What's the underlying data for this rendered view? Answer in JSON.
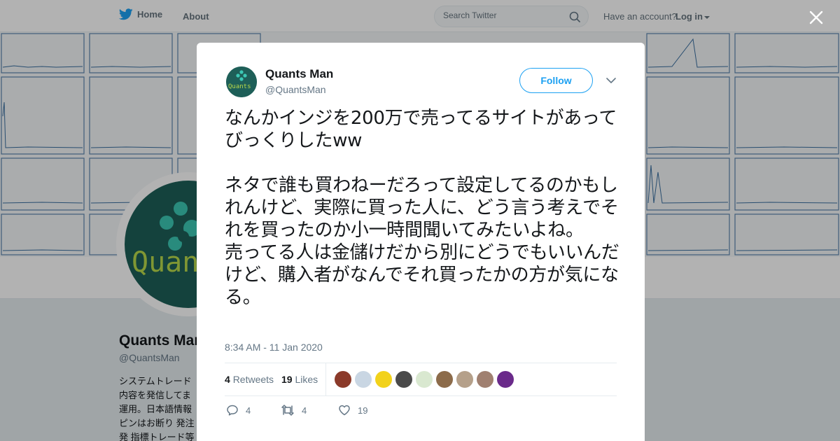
{
  "nav": {
    "home_label": "Home",
    "about_label": "About",
    "search_placeholder": "Search Twitter",
    "have_account": "Have an account?",
    "login_label": "Log in"
  },
  "background_profile": {
    "name": "Quants Man",
    "handle": "@QuantsMan",
    "bio": "システムトレード\n内容を発信してま\n運用。日本語情報\nピンはお断り 発注\n発 指標トレード等"
  },
  "tweet": {
    "author_name": "Quants Man",
    "author_handle": "@QuantsMan",
    "follow_label": "Follow",
    "text": "なんかインジを200万で売ってるサイトがあってびっくりしたww\n\nネタで誰も買わねーだろって設定してるのかもしれんけど、実際に買った人に、どう言う考えでそれを買ったのか小一時間聞いてみたいよね。\n売ってる人は金儲けだから別にどうでもいいんだけど、購入者がなんでそれ買ったかの方が気になる。",
    "timestamp": "8:34 AM - 11 Jan 2020",
    "retweets_count": "4",
    "retweets_label": "Retweets",
    "likes_count": "19",
    "likes_label": "Likes",
    "reply_count": "4",
    "retweet_count": "4",
    "like_count": "19"
  },
  "colors": {
    "accent": "#1da1f2",
    "avatar_bg": "#1e5f58",
    "muted": "#657786"
  },
  "liker_avatar_colors": [
    "#8b3a2a",
    "#c9d6e3",
    "#f2d21b",
    "#4a4a4a",
    "#d9e8d0",
    "#8c6b4a",
    "#b5a08a",
    "#a08070",
    "#6a2a8a"
  ]
}
